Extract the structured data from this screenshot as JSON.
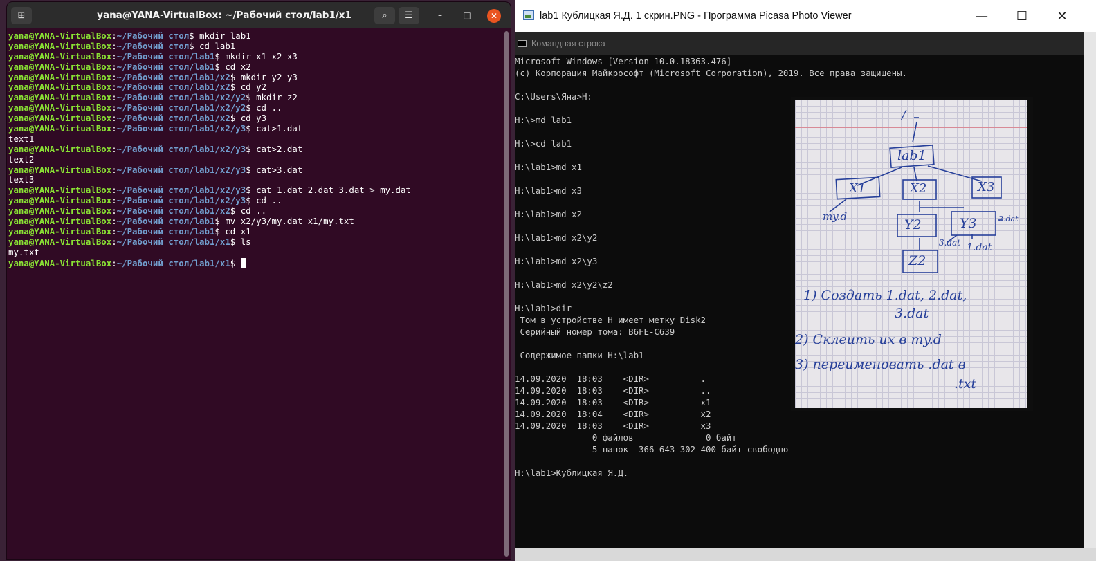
{
  "terminal": {
    "title": "yana@YANA-VirtualBox: ~/Рабочий стол/lab1/x1",
    "lines": [
      {
        "user": "yana@YANA-VirtualBox",
        "path": "~/Рабочий стол",
        "cmd": " mkdir lab1"
      },
      {
        "user": "yana@YANA-VirtualBox",
        "path": "~/Рабочий стол",
        "cmd": " cd lab1"
      },
      {
        "user": "yana@YANA-VirtualBox",
        "path": "~/Рабочий стол/lab1",
        "cmd": " mkdir x1 x2 x3"
      },
      {
        "user": "yana@YANA-VirtualBox",
        "path": "~/Рабочий стол/lab1",
        "cmd": " cd x2"
      },
      {
        "user": "yana@YANA-VirtualBox",
        "path": "~/Рабочий стол/lab1/x2",
        "cmd": " mkdir y2 y3"
      },
      {
        "user": "yana@YANA-VirtualBox",
        "path": "~/Рабочий стол/lab1/x2",
        "cmd": " cd y2"
      },
      {
        "user": "yana@YANA-VirtualBox",
        "path": "~/Рабочий стол/lab1/x2/y2",
        "cmd": " mkdir z2"
      },
      {
        "user": "yana@YANA-VirtualBox",
        "path": "~/Рабочий стол/lab1/x2/y2",
        "cmd": " cd .."
      },
      {
        "user": "yana@YANA-VirtualBox",
        "path": "~/Рабочий стол/lab1/x2",
        "cmd": " cd y3"
      },
      {
        "user": "yana@YANA-VirtualBox",
        "path": "~/Рабочий стол/lab1/x2/y3",
        "cmd": " cat>1.dat"
      },
      {
        "text": "text1"
      },
      {
        "user": "yana@YANA-VirtualBox",
        "path": "~/Рабочий стол/lab1/x2/y3",
        "cmd": " cat>2.dat"
      },
      {
        "text": "text2"
      },
      {
        "user": "yana@YANA-VirtualBox",
        "path": "~/Рабочий стол/lab1/x2/y3",
        "cmd": " cat>3.dat"
      },
      {
        "text": "text3"
      },
      {
        "user": "yana@YANA-VirtualBox",
        "path": "~/Рабочий стол/lab1/x2/y3",
        "cmd": " cat 1.dat 2.dat 3.dat > my.dat"
      },
      {
        "user": "yana@YANA-VirtualBox",
        "path": "~/Рабочий стол/lab1/x2/y3",
        "cmd": " cd .."
      },
      {
        "user": "yana@YANA-VirtualBox",
        "path": "~/Рабочий стол/lab1/x2",
        "cmd": " cd .."
      },
      {
        "user": "yana@YANA-VirtualBox",
        "path": "~/Рабочий стол/lab1",
        "cmd": " mv x2/y3/my.dat x1/my.txt"
      },
      {
        "user": "yana@YANA-VirtualBox",
        "path": "~/Рабочий стол/lab1",
        "cmd": " cd x1"
      },
      {
        "user": "yana@YANA-VirtualBox",
        "path": "~/Рабочий стол/lab1/x1",
        "cmd": " ls"
      },
      {
        "text": "my.txt"
      },
      {
        "user": "yana@YANA-VirtualBox",
        "path": "~/Рабочий стол/lab1/x1",
        "cmd": " ",
        "cursor": true
      }
    ]
  },
  "picasa": {
    "title": "lab1 Кублицкая Я.Д. 1 скрин.PNG - Программа Picasa Photo Viewer",
    "cmd_window_title": "Командная строка",
    "cmd_lines": [
      "Microsoft Windows [Version 10.0.18363.476]",
      "(c) Корпорация Майкрософт (Microsoft Corporation), 2019. Все права защищены.",
      "",
      "C:\\Users\\Яна>H:",
      "",
      "H:\\>md lab1",
      "",
      "H:\\>cd lab1",
      "",
      "H:\\lab1>md x1",
      "",
      "H:\\lab1>md x3",
      "",
      "H:\\lab1>md x2",
      "",
      "H:\\lab1>md x2\\y2",
      "",
      "H:\\lab1>md x2\\y3",
      "",
      "H:\\lab1>md x2\\y2\\z2",
      "",
      "H:\\lab1>dir",
      " Том в устройстве H имеет метку Disk2",
      " Серийный номер тома: B6FE-C639",
      "",
      " Содержимое папки H:\\lab1",
      "",
      "14.09.2020  18:03    <DIR>          .",
      "14.09.2020  18:03    <DIR>          ..",
      "14.09.2020  18:03    <DIR>          x1",
      "14.09.2020  18:04    <DIR>          x2",
      "14.09.2020  18:03    <DIR>          x3",
      "               0 файлов              0 байт",
      "               5 папок  366 643 302 400 байт свободно",
      "",
      "H:\\lab1>Кублицкая Я.Д."
    ],
    "note": {
      "root": "/",
      "lab1": "lab1",
      "x1": "X1",
      "x2": "X2",
      "x3": "X3",
      "y2": "Y2",
      "y3": "Y3",
      "z2": "Z2",
      "myd": "my.d",
      "dat2": "2.dat",
      "dat3": "3.dat",
      "dat1": "1.dat",
      "task1a": "1) Создать  1.dat, 2.dat,",
      "task1b": "3.dat",
      "task2": "2) Склеить  их в my.d",
      "task3a": "3) переименовать  .dat в",
      "task3b": ".txt"
    }
  }
}
